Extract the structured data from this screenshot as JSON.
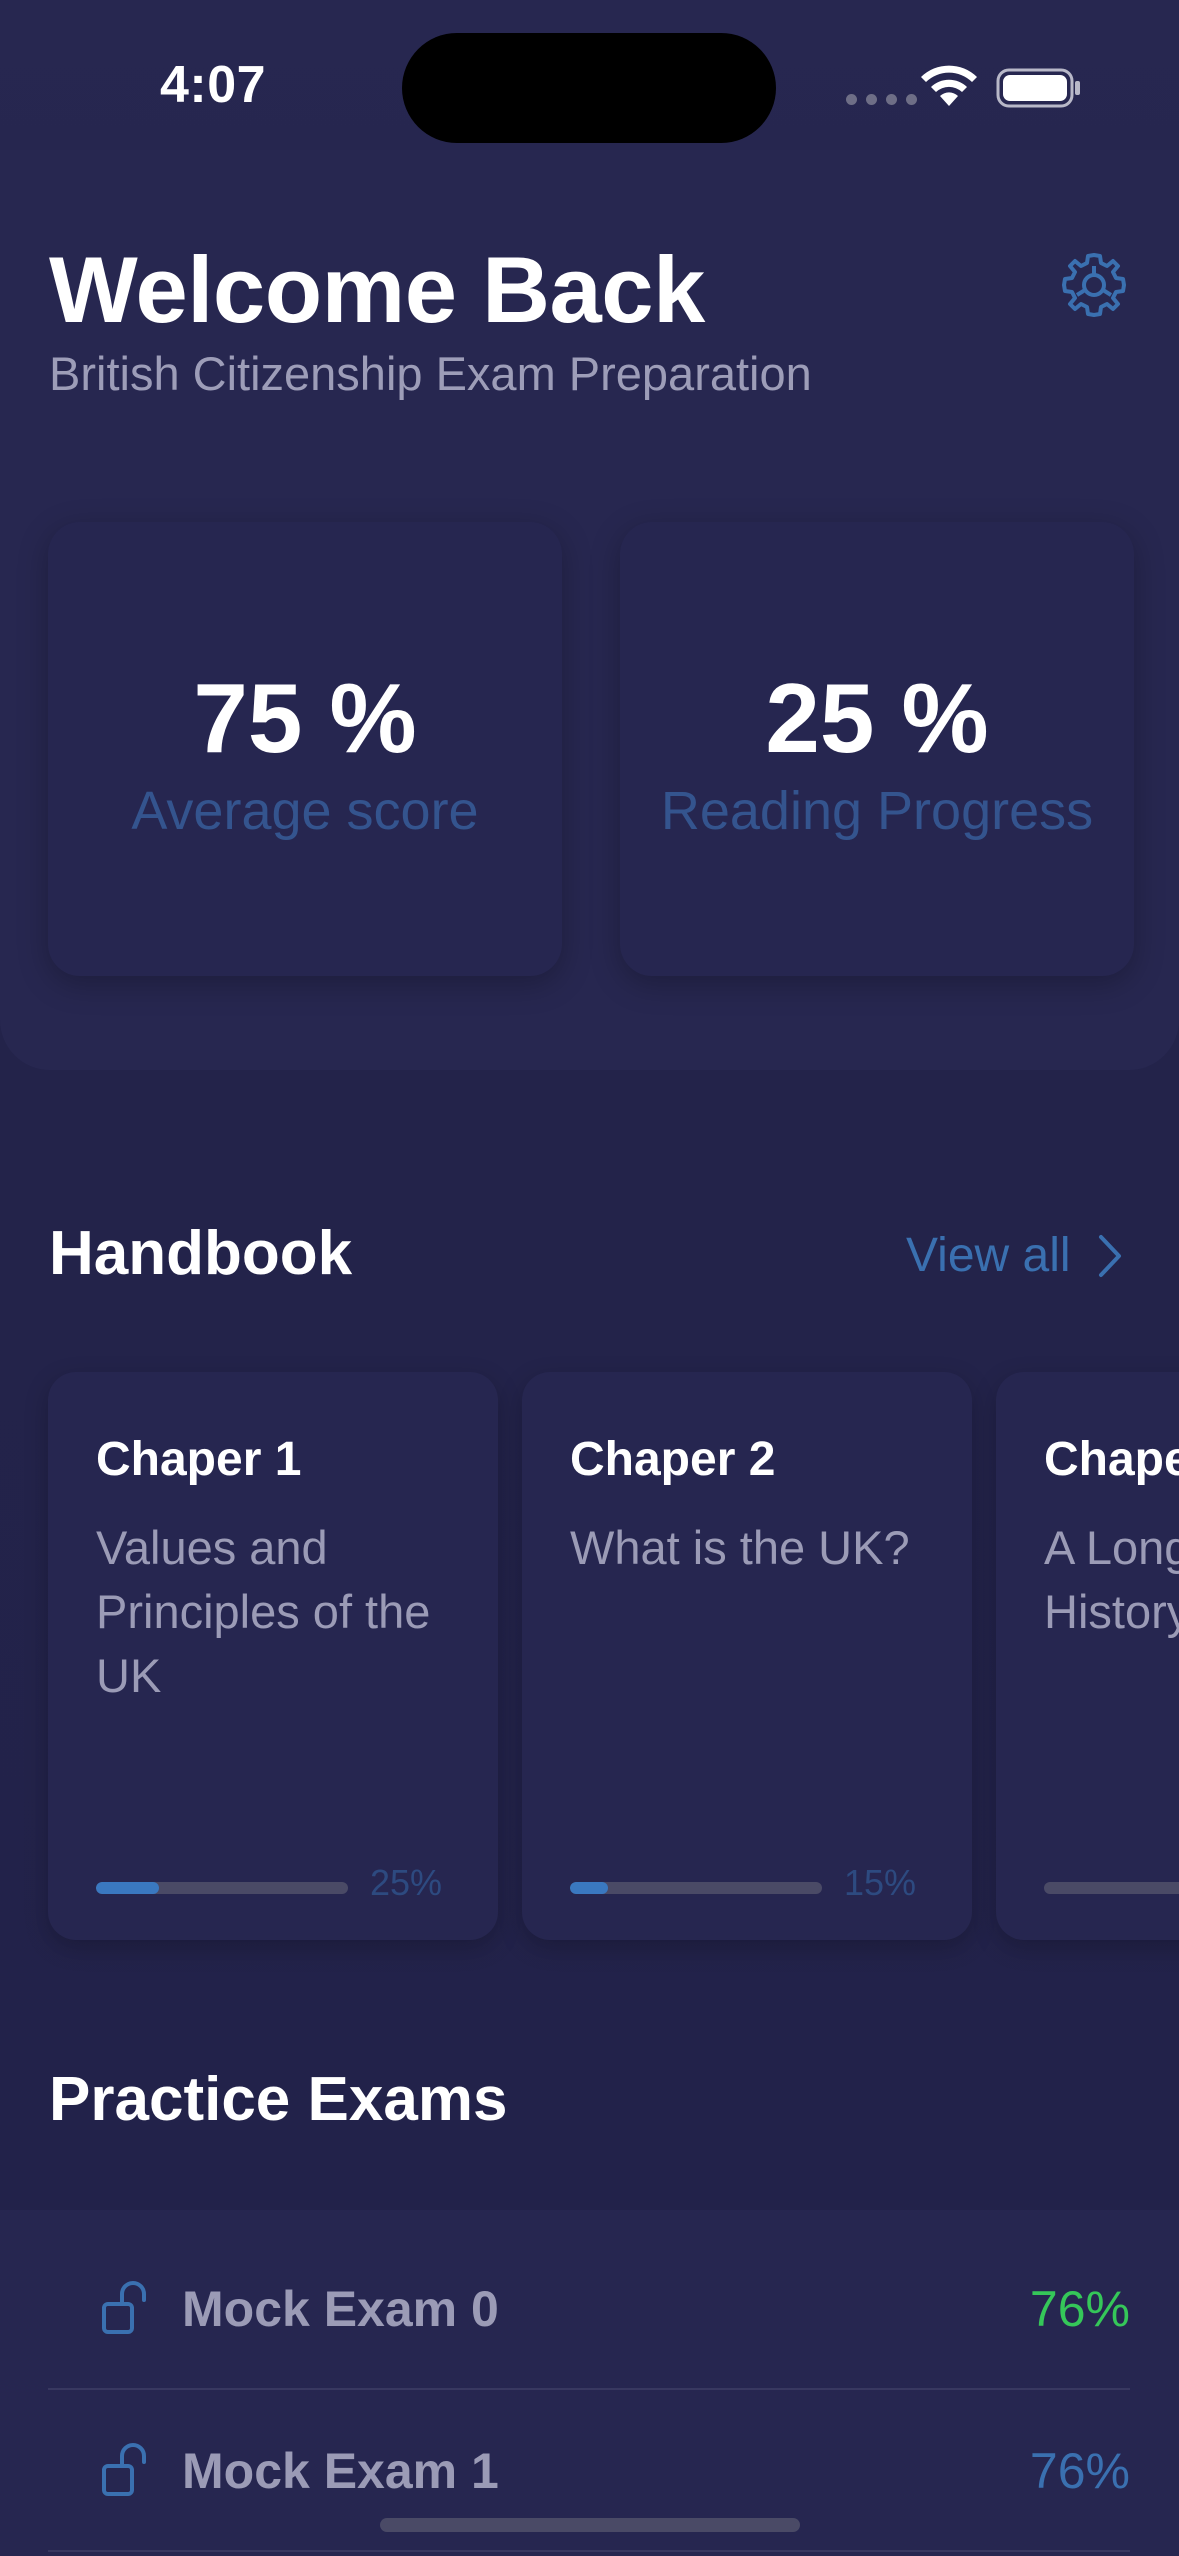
{
  "status_bar": {
    "time": "4:07"
  },
  "header": {
    "title": "Welcome Back",
    "subtitle": "British Citizenship Exam Preparation",
    "settings_icon": "gear-icon"
  },
  "stats": [
    {
      "value": "75 %",
      "label": "Average score"
    },
    {
      "value": "25 %",
      "label": "Reading Progress"
    }
  ],
  "handbook": {
    "title": "Handbook",
    "view_all_label": "View all",
    "chapters": [
      {
        "title": "Chaper 1",
        "description": "Values and Principles of the UK",
        "progress": 0.25,
        "progress_label": "25%"
      },
      {
        "title": "Chaper 2",
        "description": "What is the UK?",
        "progress": 0.15,
        "progress_label": "15%"
      },
      {
        "title": "Chape",
        "description": "A Long Illustrious History",
        "progress": 0.0,
        "progress_label": ""
      }
    ]
  },
  "practice_exams": {
    "title": "Practice Exams",
    "exams": [
      {
        "name": "Mock Exam 0",
        "score": "76%",
        "score_color": "#35c759"
      },
      {
        "name": "Mock Exam 1",
        "score": "76%",
        "score_color": "#3a70b0"
      }
    ]
  },
  "colors": {
    "background": "#232346",
    "accent": "#3a70b0",
    "success": "#35c759",
    "muted_text": "#9b9bb6"
  }
}
